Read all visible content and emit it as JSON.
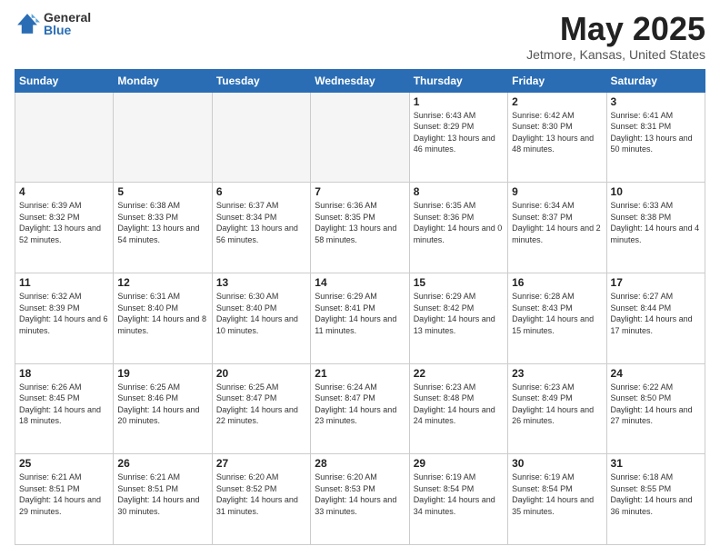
{
  "header": {
    "logo_general": "General",
    "logo_blue": "Blue",
    "month_title": "May 2025",
    "location": "Jetmore, Kansas, United States"
  },
  "weekdays": [
    "Sunday",
    "Monday",
    "Tuesday",
    "Wednesday",
    "Thursday",
    "Friday",
    "Saturday"
  ],
  "weeks": [
    [
      {
        "day": "",
        "empty": true
      },
      {
        "day": "",
        "empty": true
      },
      {
        "day": "",
        "empty": true
      },
      {
        "day": "",
        "empty": true
      },
      {
        "day": "1",
        "sunrise": "6:43 AM",
        "sunset": "8:29 PM",
        "daylight": "13 hours and 46 minutes."
      },
      {
        "day": "2",
        "sunrise": "6:42 AM",
        "sunset": "8:30 PM",
        "daylight": "13 hours and 48 minutes."
      },
      {
        "day": "3",
        "sunrise": "6:41 AM",
        "sunset": "8:31 PM",
        "daylight": "13 hours and 50 minutes."
      }
    ],
    [
      {
        "day": "4",
        "sunrise": "6:39 AM",
        "sunset": "8:32 PM",
        "daylight": "13 hours and 52 minutes."
      },
      {
        "day": "5",
        "sunrise": "6:38 AM",
        "sunset": "8:33 PM",
        "daylight": "13 hours and 54 minutes."
      },
      {
        "day": "6",
        "sunrise": "6:37 AM",
        "sunset": "8:34 PM",
        "daylight": "13 hours and 56 minutes."
      },
      {
        "day": "7",
        "sunrise": "6:36 AM",
        "sunset": "8:35 PM",
        "daylight": "13 hours and 58 minutes."
      },
      {
        "day": "8",
        "sunrise": "6:35 AM",
        "sunset": "8:36 PM",
        "daylight": "14 hours and 0 minutes."
      },
      {
        "day": "9",
        "sunrise": "6:34 AM",
        "sunset": "8:37 PM",
        "daylight": "14 hours and 2 minutes."
      },
      {
        "day": "10",
        "sunrise": "6:33 AM",
        "sunset": "8:38 PM",
        "daylight": "14 hours and 4 minutes."
      }
    ],
    [
      {
        "day": "11",
        "sunrise": "6:32 AM",
        "sunset": "8:39 PM",
        "daylight": "14 hours and 6 minutes."
      },
      {
        "day": "12",
        "sunrise": "6:31 AM",
        "sunset": "8:40 PM",
        "daylight": "14 hours and 8 minutes."
      },
      {
        "day": "13",
        "sunrise": "6:30 AM",
        "sunset": "8:40 PM",
        "daylight": "14 hours and 10 minutes."
      },
      {
        "day": "14",
        "sunrise": "6:29 AM",
        "sunset": "8:41 PM",
        "daylight": "14 hours and 11 minutes."
      },
      {
        "day": "15",
        "sunrise": "6:29 AM",
        "sunset": "8:42 PM",
        "daylight": "14 hours and 13 minutes."
      },
      {
        "day": "16",
        "sunrise": "6:28 AM",
        "sunset": "8:43 PM",
        "daylight": "14 hours and 15 minutes."
      },
      {
        "day": "17",
        "sunrise": "6:27 AM",
        "sunset": "8:44 PM",
        "daylight": "14 hours and 17 minutes."
      }
    ],
    [
      {
        "day": "18",
        "sunrise": "6:26 AM",
        "sunset": "8:45 PM",
        "daylight": "14 hours and 18 minutes."
      },
      {
        "day": "19",
        "sunrise": "6:25 AM",
        "sunset": "8:46 PM",
        "daylight": "14 hours and 20 minutes."
      },
      {
        "day": "20",
        "sunrise": "6:25 AM",
        "sunset": "8:47 PM",
        "daylight": "14 hours and 22 minutes."
      },
      {
        "day": "21",
        "sunrise": "6:24 AM",
        "sunset": "8:47 PM",
        "daylight": "14 hours and 23 minutes."
      },
      {
        "day": "22",
        "sunrise": "6:23 AM",
        "sunset": "8:48 PM",
        "daylight": "14 hours and 24 minutes."
      },
      {
        "day": "23",
        "sunrise": "6:23 AM",
        "sunset": "8:49 PM",
        "daylight": "14 hours and 26 minutes."
      },
      {
        "day": "24",
        "sunrise": "6:22 AM",
        "sunset": "8:50 PM",
        "daylight": "14 hours and 27 minutes."
      }
    ],
    [
      {
        "day": "25",
        "sunrise": "6:21 AM",
        "sunset": "8:51 PM",
        "daylight": "14 hours and 29 minutes."
      },
      {
        "day": "26",
        "sunrise": "6:21 AM",
        "sunset": "8:51 PM",
        "daylight": "14 hours and 30 minutes."
      },
      {
        "day": "27",
        "sunrise": "6:20 AM",
        "sunset": "8:52 PM",
        "daylight": "14 hours and 31 minutes."
      },
      {
        "day": "28",
        "sunrise": "6:20 AM",
        "sunset": "8:53 PM",
        "daylight": "14 hours and 33 minutes."
      },
      {
        "day": "29",
        "sunrise": "6:19 AM",
        "sunset": "8:54 PM",
        "daylight": "14 hours and 34 minutes."
      },
      {
        "day": "30",
        "sunrise": "6:19 AM",
        "sunset": "8:54 PM",
        "daylight": "14 hours and 35 minutes."
      },
      {
        "day": "31",
        "sunrise": "6:18 AM",
        "sunset": "8:55 PM",
        "daylight": "14 hours and 36 minutes."
      }
    ]
  ],
  "labels": {
    "sunrise": "Sunrise:",
    "sunset": "Sunset:",
    "daylight": "Daylight:"
  }
}
